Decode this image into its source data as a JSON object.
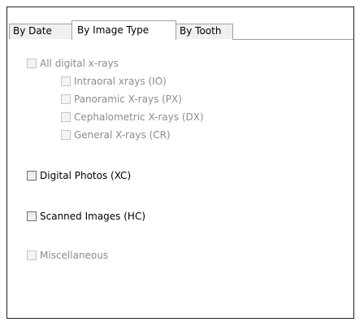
{
  "tabs": [
    {
      "label": "By Date"
    },
    {
      "label": "By Image Type"
    },
    {
      "label": "By Tooth"
    }
  ],
  "checkboxes": {
    "all_digital": {
      "label": "All digital x-rays",
      "checked": false,
      "enabled": false
    },
    "intraoral": {
      "label": "Intraoral xrays (IO)",
      "checked": false,
      "enabled": false
    },
    "panoramic": {
      "label": "Panoramic X-rays (PX)",
      "checked": false,
      "enabled": false
    },
    "cephalometric": {
      "label": "Cephalometric X-rays (DX)",
      "checked": false,
      "enabled": false
    },
    "general": {
      "label": "General X-rays (CR)",
      "checked": false,
      "enabled": false
    },
    "digital_photos": {
      "label": "Digital Photos (XC)",
      "checked": false,
      "enabled": true
    },
    "scanned_images": {
      "label": "Scanned Images (HC)",
      "checked": false,
      "enabled": true
    },
    "miscellaneous": {
      "label": "Miscellaneous",
      "checked": false,
      "enabled": false
    }
  }
}
